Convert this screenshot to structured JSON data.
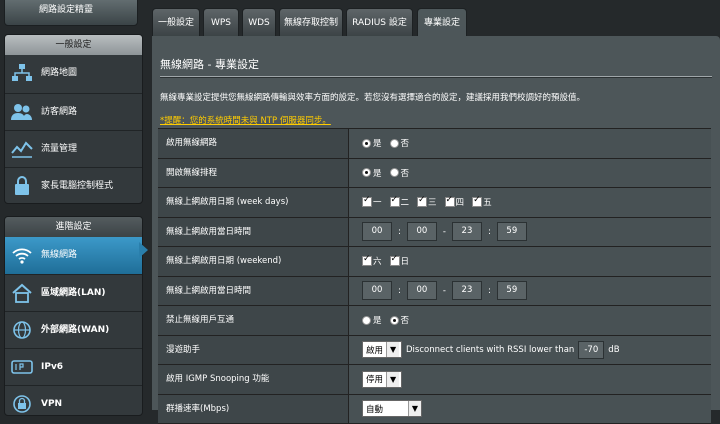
{
  "sidebar": {
    "top_button": "網路設定精靈",
    "general_header": "一般設定",
    "general_items": [
      {
        "label": "網路地圖",
        "icon": "network-map-icon"
      },
      {
        "label": "訪客網路",
        "icon": "guest-network-icon"
      },
      {
        "label": "流量管理",
        "icon": "traffic-manager-icon"
      },
      {
        "label": "家長電腦控制程式",
        "icon": "parental-control-icon"
      }
    ],
    "advanced_header": "進階設定",
    "advanced_items": [
      {
        "label": "無線網路",
        "icon": "wireless-icon",
        "active": true
      },
      {
        "label": "區域網路(LAN)",
        "icon": "lan-icon"
      },
      {
        "label": "外部網路(WAN)",
        "icon": "wan-icon"
      },
      {
        "label": "IPv6",
        "icon": "ipv6-icon"
      },
      {
        "label": "VPN",
        "icon": "vpn-icon"
      }
    ]
  },
  "tabs": [
    {
      "label": "一般設定"
    },
    {
      "label": "WPS"
    },
    {
      "label": "WDS"
    },
    {
      "label": "無線存取控制"
    },
    {
      "label": "RADIUS 設定"
    },
    {
      "label": "專業設定",
      "active": true
    }
  ],
  "main": {
    "title": "無線網路 - 專業設定",
    "description": "無線專業設定提供您無線網路傳輸與效率方面的設定。若您沒有選擇適合的設定，建議採用我們校調好的預設值。",
    "warning": "*提醒：您的系統時間未與 NTP 伺服器同步。",
    "rows": {
      "enable_radio": {
        "label": "啟用無線網路",
        "opt_yes": "是",
        "opt_no": "否"
      },
      "schedule": {
        "label": "開啟無線排程",
        "opt_yes": "是",
        "opt_no": "否"
      },
      "weekdays": {
        "label": "無線上網啟用日期 (week days)",
        "days": [
          "一",
          "二",
          "三",
          "四",
          "五"
        ]
      },
      "weekday_time": {
        "label": "無線上網啟用當日時間",
        "start_h": "00",
        "start_m": "00",
        "dash": "-",
        "end_h": "23",
        "end_m": "59",
        "colon": ":"
      },
      "weekend": {
        "label": "無線上網啟用日期 (weekend)",
        "days": [
          "六",
          "日"
        ]
      },
      "weekend_time": {
        "label": "無線上網啟用當日時間",
        "start_h": "00",
        "start_m": "00",
        "dash": "-",
        "end_h": "23",
        "end_m": "59",
        "colon": ":"
      },
      "isolation": {
        "label": "禁止無線用戶互通",
        "opt_yes": "是",
        "opt_no": "否"
      },
      "roaming": {
        "label": "漫遊助手",
        "select": "啟用",
        "text": "Disconnect clients with RSSI lower than",
        "rssi": "-70",
        "unit": "dB"
      },
      "igmp": {
        "label": "啟用 IGMP Snooping 功能",
        "select": "停用"
      },
      "multicast": {
        "label": "群播速率(Mbps)",
        "select": "自動"
      }
    }
  }
}
